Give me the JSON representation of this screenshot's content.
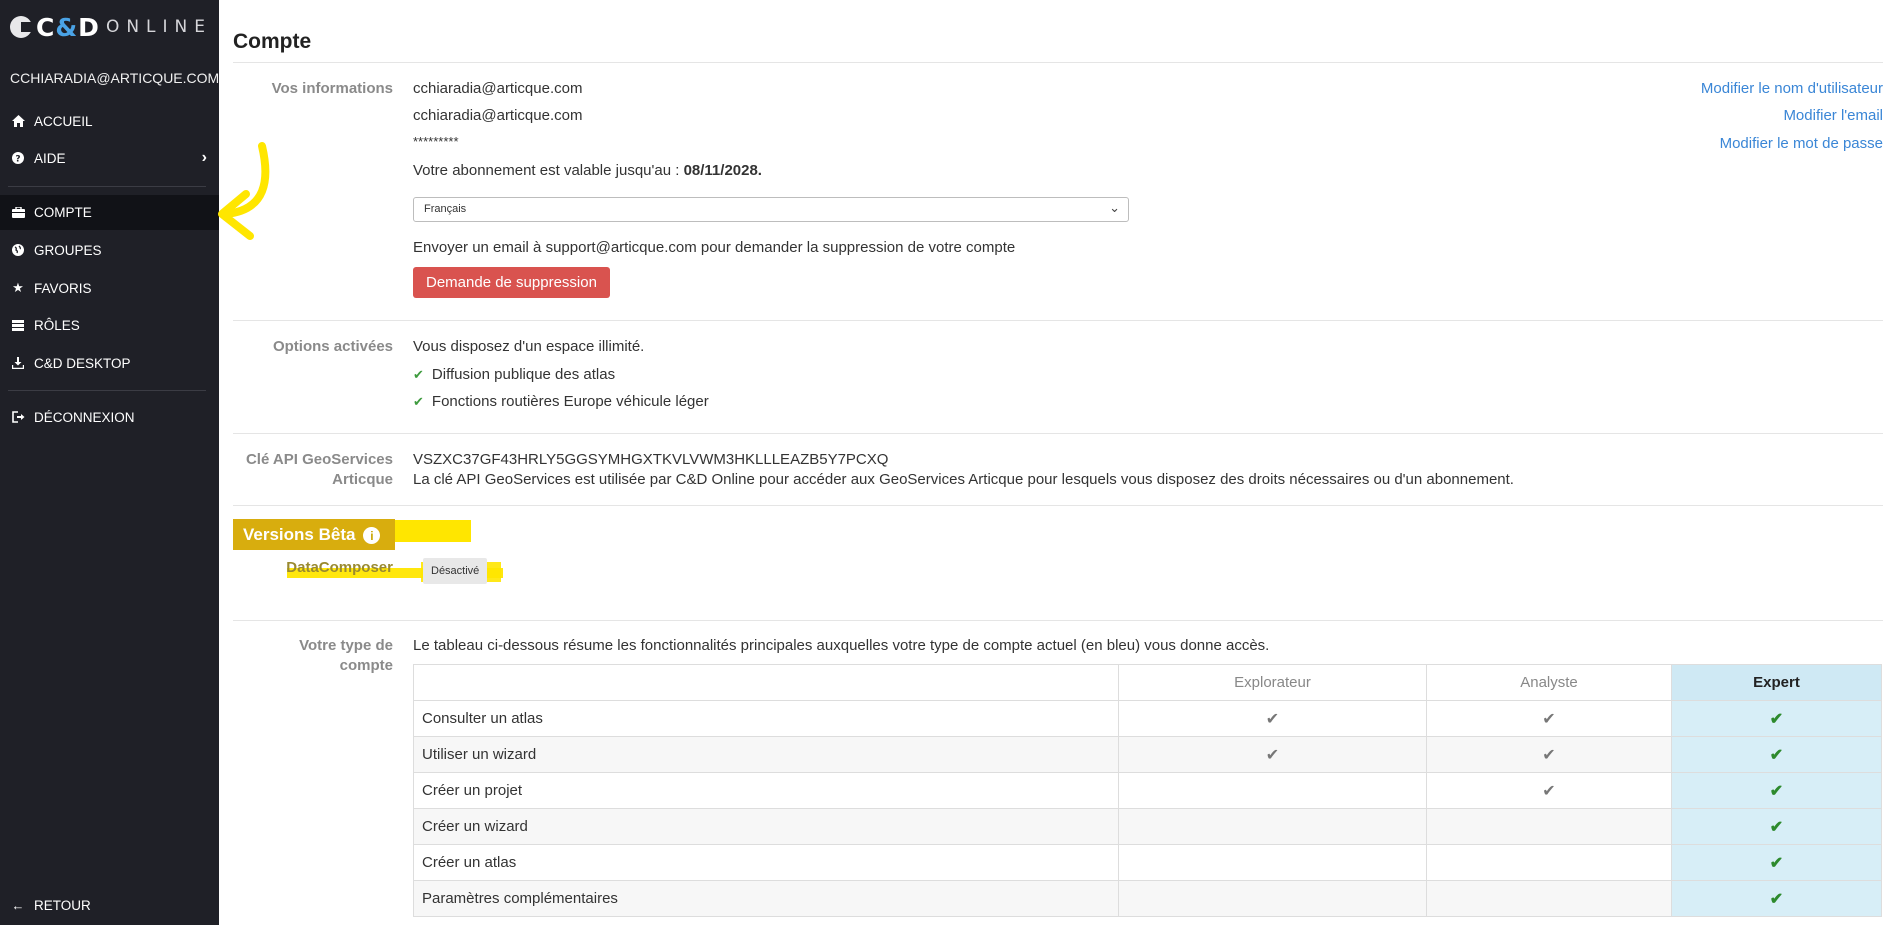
{
  "app": {
    "logo_cd_1": "C",
    "logo_amp": "&",
    "logo_cd_2": "D",
    "logo_online": "ONLINE"
  },
  "sidebar": {
    "user": "CCHIARADIA@ARTICQUE.COM",
    "items": [
      {
        "label": "ACCUEIL",
        "icon": "home-icon"
      },
      {
        "label": "AIDE",
        "icon": "help-icon"
      },
      {
        "label": "COMPTE",
        "icon": "briefcase-icon"
      },
      {
        "label": "GROUPES",
        "icon": "globe-icon"
      },
      {
        "label": "FAVORIS",
        "icon": "star-icon"
      },
      {
        "label": "RÔLES",
        "icon": "roles-icon"
      },
      {
        "label": "C&D DESKTOP",
        "icon": "download-icon"
      },
      {
        "label": "DÉCONNEXION",
        "icon": "logout-icon"
      }
    ],
    "back_label": "RETOUR"
  },
  "page": {
    "title": "Compte"
  },
  "info": {
    "label": "Vos informations",
    "username": "cchiaradia@articque.com",
    "email": "cchiaradia@articque.com",
    "password": "*********",
    "subscription_prefix": "Votre abonnement est valable jusqu'au : ",
    "subscription_date": "08/11/2028.",
    "language": "Français",
    "delete_text": "Envoyer un email à support@articque.com pour demander la suppression de votre compte",
    "delete_button": "Demande de suppression",
    "link_username": "Modifier le nom d'utilisateur",
    "link_email": "Modifier l'email",
    "link_password": "Modifier le mot de passe"
  },
  "options": {
    "label": "Options activées",
    "space": "Vous disposez d'un espace illimité.",
    "items": [
      "Diffusion publique des atlas",
      "Fonctions routières Europe véhicule léger"
    ]
  },
  "api": {
    "label_1": "Clé API GeoServices",
    "label_2": "Articque",
    "key": "VSZXC37GF43HRLY5GGSYMHGXTKVLVWM3HKLLLEAZB5Y7PCXQ",
    "description": "La clé API GeoServices est utilisée par C&D Online pour accéder aux GeoServices Articque pour lesquels vous disposez des droits nécessaires ou d'un abonnement."
  },
  "beta": {
    "title": "Versions Bêta",
    "item_label": "DataComposer",
    "toggle": "Désactivé"
  },
  "account_type": {
    "label_1": "Votre type de",
    "label_2": "compte",
    "intro": "Le tableau ci-dessous résume les fonctionnalités principales auxquelles votre type de compte actuel (en bleu) vous donne accès.",
    "columns": [
      "Explorateur",
      "Analyste",
      "Expert"
    ],
    "rows": [
      {
        "feature": "Consulter un atlas",
        "explorer": "✔",
        "analyst": "✔",
        "expert": "✔"
      },
      {
        "feature": "Utiliser un wizard",
        "explorer": "✔",
        "analyst": "✔",
        "expert": "✔"
      },
      {
        "feature": "Créer un projet",
        "explorer": "",
        "analyst": "✔",
        "expert": "✔"
      },
      {
        "feature": "Créer un wizard",
        "explorer": "",
        "analyst": "",
        "expert": "✔"
      },
      {
        "feature": "Créer un atlas",
        "explorer": "",
        "analyst": "",
        "expert": "✔"
      },
      {
        "feature": "Paramètres complémentaires",
        "explorer": "",
        "analyst": "",
        "expert": "✔"
      }
    ]
  },
  "colors": {
    "sidebar_bg": "#1f2027",
    "link": "#3a86d6",
    "danger": "#d9534f",
    "highlight": "#ffe600",
    "expert_col": "#d7eef7"
  }
}
